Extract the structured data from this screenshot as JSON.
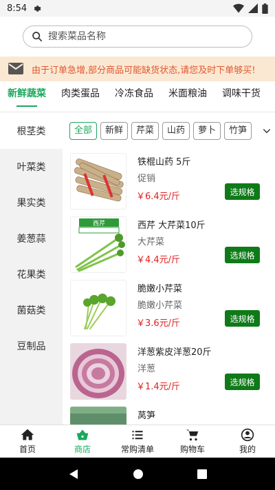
{
  "status_bar": {
    "time": "8:54"
  },
  "search": {
    "placeholder": "搜索菜品名称"
  },
  "notice": {
    "text": "由于订单急增,部分商品可能缺货状态,请您及时下单够买!"
  },
  "tabs": [
    "新鲜蔬菜",
    "肉类蛋品",
    "冷冻食品",
    "米面粮油",
    "调味干货"
  ],
  "sidebar": [
    "根茎类",
    "叶菜类",
    "果实类",
    "姜葱蒜",
    "花果类",
    "菌菇类",
    "豆制品"
  ],
  "chips": [
    "全部",
    "新鲜",
    "芹菜",
    "山药",
    "萝卜",
    "竹笋"
  ],
  "products": [
    {
      "name": "铁棍山药 5斤",
      "sub": "促销",
      "price": "￥6.4元/斤",
      "button": "选规格"
    },
    {
      "name": "西芹 大芹菜10斤",
      "sub": "大芹菜",
      "price": "￥4.4元/斤",
      "button": "选规格",
      "thumb_label": "西芹"
    },
    {
      "name": "脆嫩小芹菜",
      "sub": "脆嫩小芹菜",
      "price": "￥3.6元/斤",
      "button": "选规格"
    },
    {
      "name": "洋葱紫皮洋葱20斤",
      "sub": "洋葱",
      "price": "￥1.4元/斤",
      "button": "选规格"
    },
    {
      "name": "莴笋"
    }
  ],
  "bottom_nav": [
    "首页",
    "商店",
    "常购清单",
    "购物车",
    "我的"
  ],
  "colors": {
    "accent": "#1aa85c",
    "price": "#e02020",
    "button": "#0f7a18",
    "notice_bg": "#fbe8d3",
    "notice_text": "#e0572f"
  }
}
